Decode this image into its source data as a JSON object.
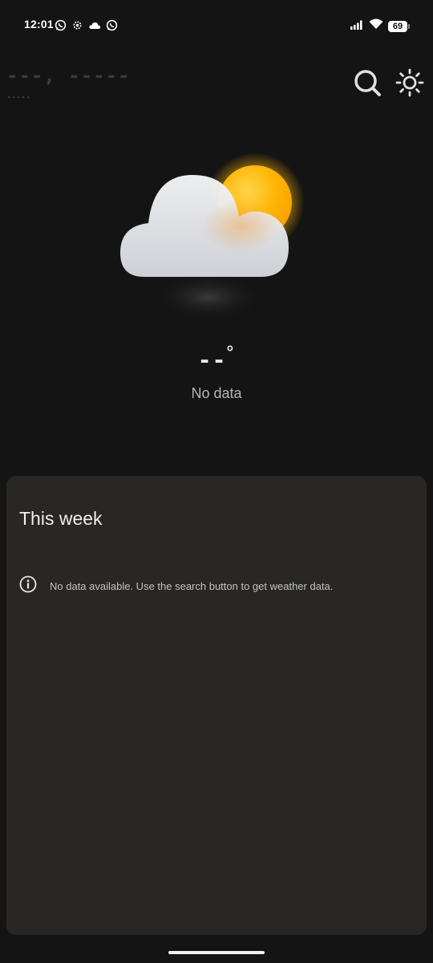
{
  "status_bar": {
    "time": "12:01",
    "left_icons": [
      "whatsapp-icon",
      "settings-icon",
      "cloud-icon",
      "whatsapp-icon"
    ],
    "right_icons": [
      "signal-icon",
      "wifi-icon"
    ],
    "battery": "69"
  },
  "header": {
    "location_placeholder": "---, -----",
    "date_placeholder": "-----",
    "search_icon": "search-icon",
    "theme_icon": "sun-icon"
  },
  "current": {
    "icon": "partly-cloudy-icon",
    "temperature": "--",
    "degree_symbol": "°",
    "condition": "No data"
  },
  "week": {
    "title": "This week",
    "info_icon": "info-icon",
    "message": "No data available. Use the search button to get weather data."
  },
  "colors": {
    "background": "#141414",
    "card": "#282726",
    "sun": "#ffb300",
    "cloud": "#e2e4e8"
  }
}
